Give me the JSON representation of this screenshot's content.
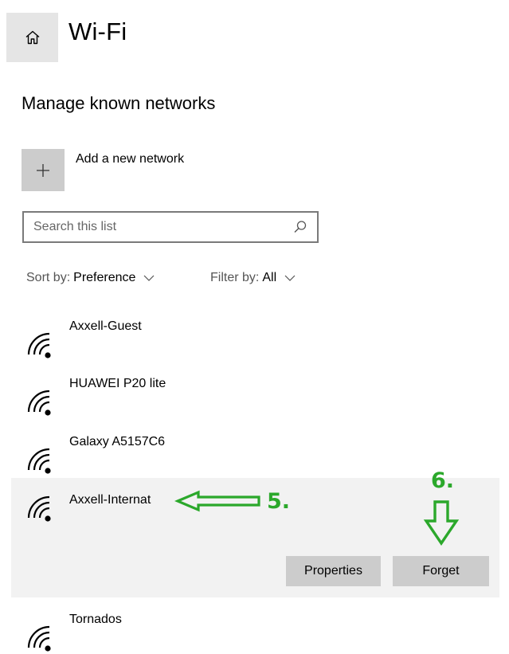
{
  "header": {
    "title": "Wi-Fi",
    "home_icon": "home-icon"
  },
  "section": {
    "title": "Manage known networks"
  },
  "add_network": {
    "label": "Add a new network",
    "icon": "plus-icon"
  },
  "search": {
    "placeholder": "Search this list",
    "icon": "search-icon"
  },
  "sort": {
    "label": "Sort by:",
    "value": "Preference"
  },
  "filter": {
    "label": "Filter by:",
    "value": "All"
  },
  "networks": [
    {
      "name": "Axxell-Guest"
    },
    {
      "name": "HUAWEI P20 lite"
    },
    {
      "name": "Galaxy A5157C6"
    },
    {
      "name": "Axxell-Internat",
      "selected": true
    },
    {
      "name": "Tornados"
    }
  ],
  "selected_actions": {
    "properties_label": "Properties",
    "forget_label": "Forget"
  },
  "annotations": {
    "step5": "5.",
    "step6": "6."
  },
  "colors": {
    "annotation": "#2ba82b",
    "button": "#cccccc",
    "selected_bg": "#f2f2f2",
    "home_bg": "#e5e5e5"
  }
}
